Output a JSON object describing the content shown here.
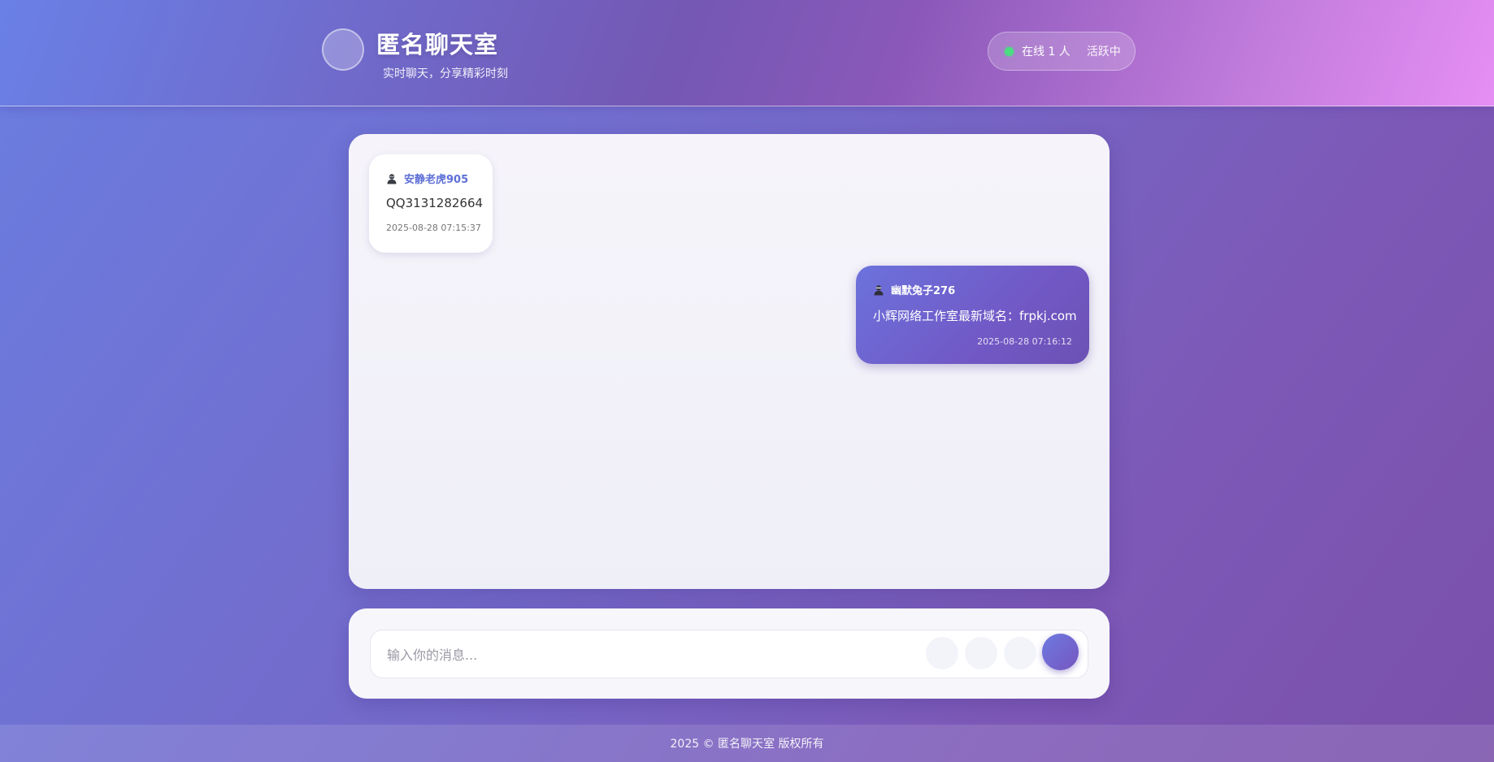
{
  "header": {
    "title": "匿名聊天室",
    "subtitle": "实时聊天，分享精彩时刻",
    "online_count": "在线 1 人",
    "status": "活跃中",
    "logo_icon": "logo-circle-icon",
    "status_icon": "online-dot-icon"
  },
  "messages": [
    {
      "user": "安静老虎905",
      "icon": "user-icon",
      "text": "QQ3131282664",
      "time": "2025-08-28 07:15:37",
      "side": "left"
    },
    {
      "user": "幽默兔子276",
      "icon": "user-icon",
      "text": "小辉网络工作室最新域名：frpkj.com",
      "time": "2025-08-28 07:16:12",
      "side": "right"
    }
  ],
  "composer": {
    "placeholder": "输入你的消息...",
    "tool_icons": [
      "emoji-icon",
      "image-icon",
      "attachment-icon"
    ],
    "send_icon": "send-icon"
  },
  "footer": {
    "text": "2025 © 匿名聊天室 版权所有"
  },
  "colors": {
    "accent": "#6d6fdc",
    "header_end": "#e68ef4",
    "online_dot": "#4ade80",
    "username_left": "#5d6fd6"
  }
}
